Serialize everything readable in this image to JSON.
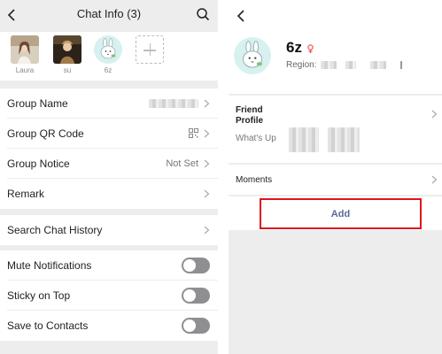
{
  "left_panel": {
    "header": {
      "title": "Chat Info (3)",
      "back_icon": "chevron-left-icon",
      "search_icon": "search-icon"
    },
    "members": [
      {
        "name": "Laura",
        "avatar": "photo-avatar"
      },
      {
        "name": "su",
        "avatar": "photo-avatar"
      },
      {
        "name": "6z",
        "avatar": "bunny-avatar"
      }
    ],
    "add_member_icon": "plus-icon",
    "settings_rows": [
      {
        "label": "Group Name",
        "value": ""
      },
      {
        "label": "Group QR Code",
        "icon": "qr-code-icon"
      },
      {
        "label": "Group Notice",
        "value": "Not Set"
      },
      {
        "label": "Remark",
        "value": ""
      }
    ],
    "search_history": {
      "label": "Search Chat History"
    },
    "toggles": [
      {
        "label": "Mute Notifications",
        "on": false
      },
      {
        "label": "Sticky on Top",
        "on": false
      },
      {
        "label": "Save to Contacts",
        "on": false
      }
    ]
  },
  "right_panel": {
    "back_icon": "chevron-left-icon",
    "profile": {
      "name": "6z",
      "gender_icon": "female-icon",
      "region_label": "Region:"
    },
    "friend_profile": {
      "label": "Friend Profile",
      "whats_up_label": "What's Up"
    },
    "moments": {
      "label": "Moments"
    },
    "add_button": {
      "label": "Add"
    }
  },
  "colors": {
    "highlight_border": "#e0141e",
    "add_text": "#576b95",
    "toggle_off": "#8e8e93",
    "gender_female": "#ec5d5d"
  }
}
